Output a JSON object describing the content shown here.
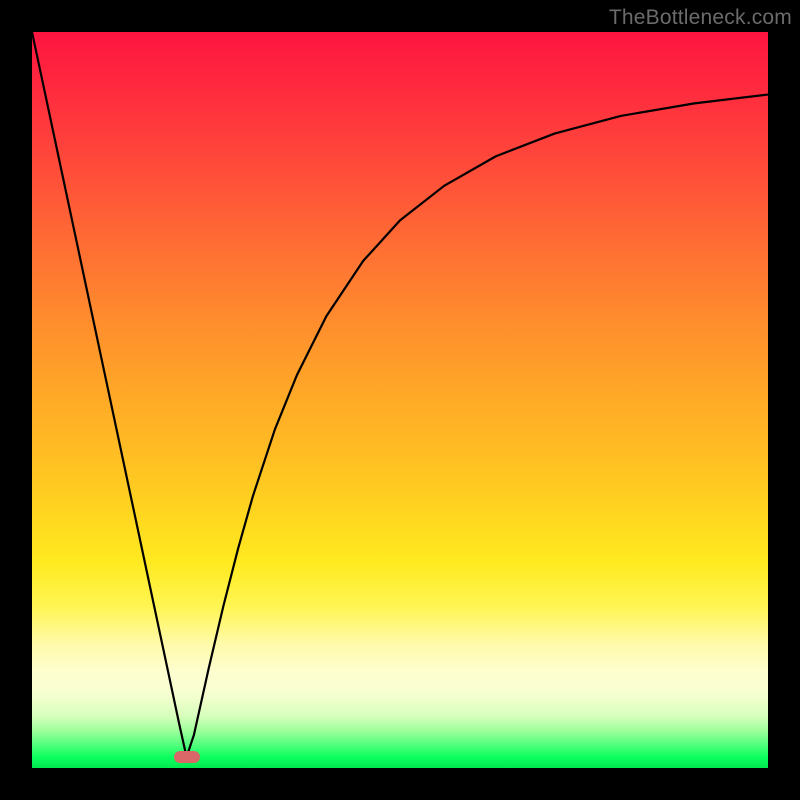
{
  "attribution": "TheBottleneck.com",
  "chart_data": {
    "type": "line",
    "title": "",
    "xlabel": "",
    "ylabel": "",
    "xlim": [
      0,
      100
    ],
    "ylim": [
      0,
      100
    ],
    "grid": false,
    "legend": false,
    "marker": {
      "x": 21,
      "y": 1.5,
      "color": "#da6868"
    },
    "series": [
      {
        "name": "curve",
        "color": "#000000",
        "x": [
          0,
          2,
          4,
          6,
          8,
          10,
          12,
          14,
          16,
          18,
          20,
          21,
          22,
          24,
          26,
          28,
          30,
          33,
          36,
          40,
          45,
          50,
          56,
          63,
          71,
          80,
          90,
          100
        ],
        "y": [
          100,
          90.6,
          81.2,
          71.8,
          62.4,
          53.0,
          43.6,
          34.2,
          24.8,
          15.4,
          6.0,
          1.5,
          4.5,
          13.5,
          22.0,
          29.8,
          36.9,
          46.0,
          53.4,
          61.4,
          68.9,
          74.4,
          79.1,
          83.1,
          86.2,
          88.6,
          90.3,
          91.5
        ]
      }
    ],
    "background_gradient": {
      "stops": [
        {
          "pos": 0,
          "color": "#fe1540"
        },
        {
          "pos": 18,
          "color": "#ff4a3a"
        },
        {
          "pos": 38,
          "color": "#ff892e"
        },
        {
          "pos": 58,
          "color": "#ffbf23"
        },
        {
          "pos": 78,
          "color": "#fff552"
        },
        {
          "pos": 90,
          "color": "#f6ffd0"
        },
        {
          "pos": 97,
          "color": "#4bff7a"
        },
        {
          "pos": 100,
          "color": "#00e84f"
        }
      ]
    }
  }
}
